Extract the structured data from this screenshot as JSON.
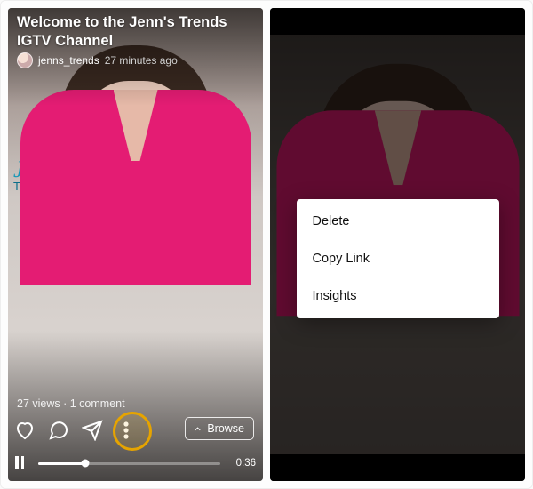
{
  "left": {
    "title": "Welcome to the Jenn's Trends IGTV Channel",
    "author": {
      "handle": "jenns_trends",
      "time": "27 minutes ago"
    },
    "brand": {
      "line1": "Jenn's",
      "line2": "TRENDS"
    },
    "stats": {
      "text": "27 views · 1 comment"
    },
    "browse_label": "Browse",
    "duration": "0:36",
    "progress_pct": 26
  },
  "right": {
    "menu": {
      "delete": "Delete",
      "copy": "Copy Link",
      "insights": "Insights"
    }
  }
}
